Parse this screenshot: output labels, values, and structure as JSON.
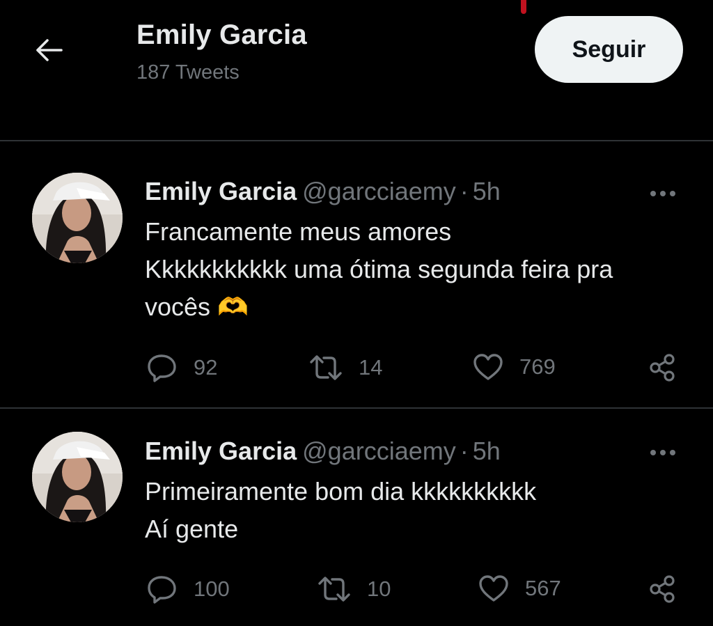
{
  "header": {
    "title": "Emily Garcia",
    "tweet_count": "187 Tweets",
    "follow_label": "Seguir"
  },
  "tweets": [
    {
      "name": "Emily Garcia",
      "handle": "@garcciaemy",
      "separator": "·",
      "time": "5h",
      "text_lines": [
        "Francamente meus amores",
        "Kkkkkkkkkkk uma ótima segunda feira pra",
        "vocês 🫶"
      ],
      "replies": "92",
      "retweets": "14",
      "likes": "769"
    },
    {
      "name": "Emily Garcia",
      "handle": "@garcciaemy",
      "separator": "·",
      "time": "5h",
      "text_lines": [
        "Primeiramente bom dia kkkkkkkkkk",
        "Aí gente"
      ],
      "replies": "100",
      "retweets": "10",
      "likes": "567"
    }
  ],
  "icons": {
    "back": "arrow-left-icon",
    "more": "more-horizontal-icon",
    "reply": "reply-icon",
    "retweet": "retweet-icon",
    "like": "heart-icon",
    "share": "share-icon"
  },
  "colors": {
    "background": "#000000",
    "text_primary": "#e7e9ea",
    "text_secondary": "#71767b",
    "follow_bg": "#eff3f4",
    "divider": "#2f3336"
  }
}
